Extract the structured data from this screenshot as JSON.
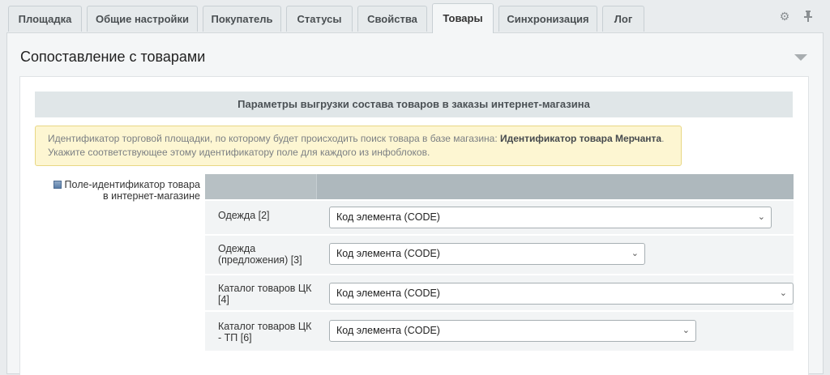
{
  "tabs": [
    {
      "label": "Площадка"
    },
    {
      "label": "Общие настройки"
    },
    {
      "label": "Покупатель"
    },
    {
      "label": "Статусы"
    },
    {
      "label": "Свойства"
    },
    {
      "label": "Товары",
      "active": true
    },
    {
      "label": "Синхронизация"
    },
    {
      "label": "Лог"
    }
  ],
  "toolbar": {
    "settings_icon": "gear-icon",
    "pin_icon": "pin-icon"
  },
  "panel": {
    "title": "Сопоставление с товарами",
    "section_heading": "Параметры выгрузки состава товаров в заказы интернет-магазина",
    "notice": {
      "text_before": "Идентификатор торговой площадки, по которому будет происходить поиск товара в базе магазина: ",
      "bold": "Идентификатор товара Мерчанта",
      "text_after": ". Укажите соответствующее этому идентификатору поле для каждого из инфоблоков."
    },
    "field_label": "Поле-идентификатор товара в интернет-магазине",
    "rows": [
      {
        "label": "Одежда [2]",
        "value": "Код элемента (CODE)"
      },
      {
        "label": "Одежда (предложения) [3]",
        "value": "Код элемента (CODE)"
      },
      {
        "label": "Каталог товаров ЦК [4]",
        "value": "Код элемента (CODE)"
      },
      {
        "label": "Каталог товаров ЦК - ТП [6]",
        "value": "Код элемента (CODE)"
      }
    ]
  },
  "colors": {
    "notice_bg": "#fdf6d2",
    "section_bg": "#e0e6e8",
    "grid_header": "#aeb8bd"
  }
}
